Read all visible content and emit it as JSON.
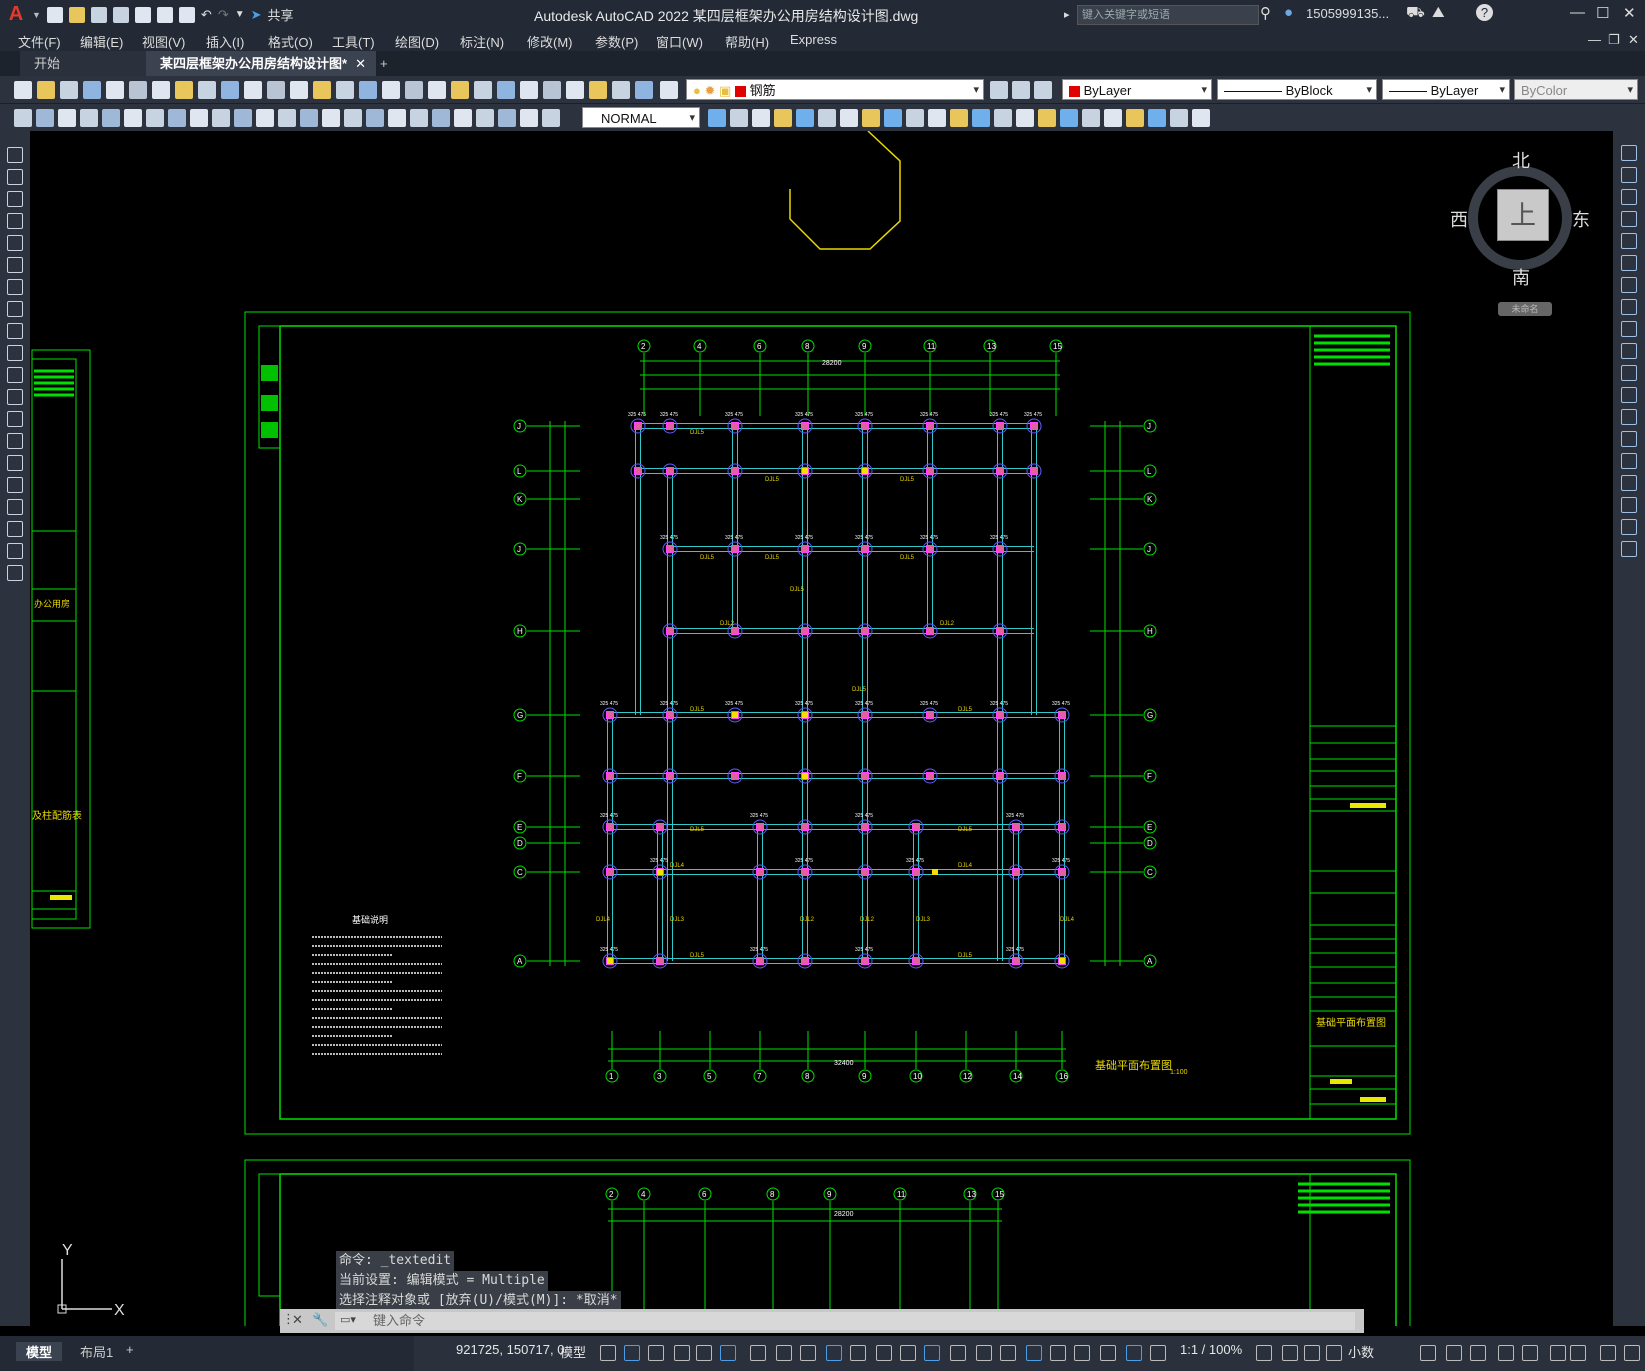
{
  "titlebar": {
    "app_title": "Autodesk AutoCAD 2022    某四层框架办公用房结构设计图.dwg",
    "share_label": "共享",
    "search_placeholder": "键入关键字或短语",
    "user_name": "1505999135...",
    "logo": "A"
  },
  "menu": [
    "文件(F)",
    "编辑(E)",
    "视图(V)",
    "插入(I)",
    "格式(O)",
    "工具(T)",
    "绘图(D)",
    "标注(N)",
    "修改(M)",
    "参数(P)",
    "窗口(W)",
    "帮助(H)",
    "Express"
  ],
  "tabs": {
    "start": "开始",
    "active_doc": "某四层框架办公用房结构设计图*",
    "close": "✕",
    "new": "+"
  },
  "properties": {
    "layer": "钢筋",
    "color": "ByLayer",
    "linetype": "ByBlock",
    "lineweight": "ByLayer",
    "plotstyle": "ByColor",
    "dimstyle": "NORMAL"
  },
  "viewcube": {
    "north": "北",
    "south": "南",
    "east": "东",
    "west": "西",
    "top": "上",
    "wcs": "未命名"
  },
  "drawing": {
    "top_grid_labels": [
      "2",
      "4",
      "6",
      "8",
      "9",
      "11",
      "13",
      "15"
    ],
    "bottom_grid_labels": [
      "1",
      "3",
      "5",
      "7",
      "8",
      "9",
      "10",
      "12",
      "14",
      "16"
    ],
    "row_labels": [
      "J",
      "L",
      "K",
      "J",
      "H",
      "G",
      "F",
      "E",
      "D",
      "C",
      "A"
    ],
    "plan_title": "基础平面布置图",
    "plan_scale": "1:100",
    "notes_title": "基础说明",
    "sheet_title": "基础平面布置图",
    "overall_dim_top": "28200",
    "overall_dim_bottom": "32400",
    "left_sheet_text1": "办公用房",
    "left_sheet_text2": "及柱配筋表",
    "lower_top_grid_labels": [
      "2",
      "4",
      "6",
      "8",
      "9",
      "11",
      "13",
      "15"
    ],
    "lower_dim": "28200"
  },
  "command": {
    "history": [
      "命令: _textedit",
      "当前设置: 编辑模式 = Multiple",
      "选择注释对象或 [放弃(U)/模式(M)]: *取消*"
    ],
    "placeholder": "键入命令"
  },
  "ucs": {
    "x": "X",
    "y": "Y"
  },
  "status": {
    "model_tab": "模型",
    "layout_tab": "布局1",
    "add": "+",
    "coords": "921725, 150717, 0",
    "space": "模型",
    "scale": "1:1 / 100%",
    "units": "小数"
  }
}
